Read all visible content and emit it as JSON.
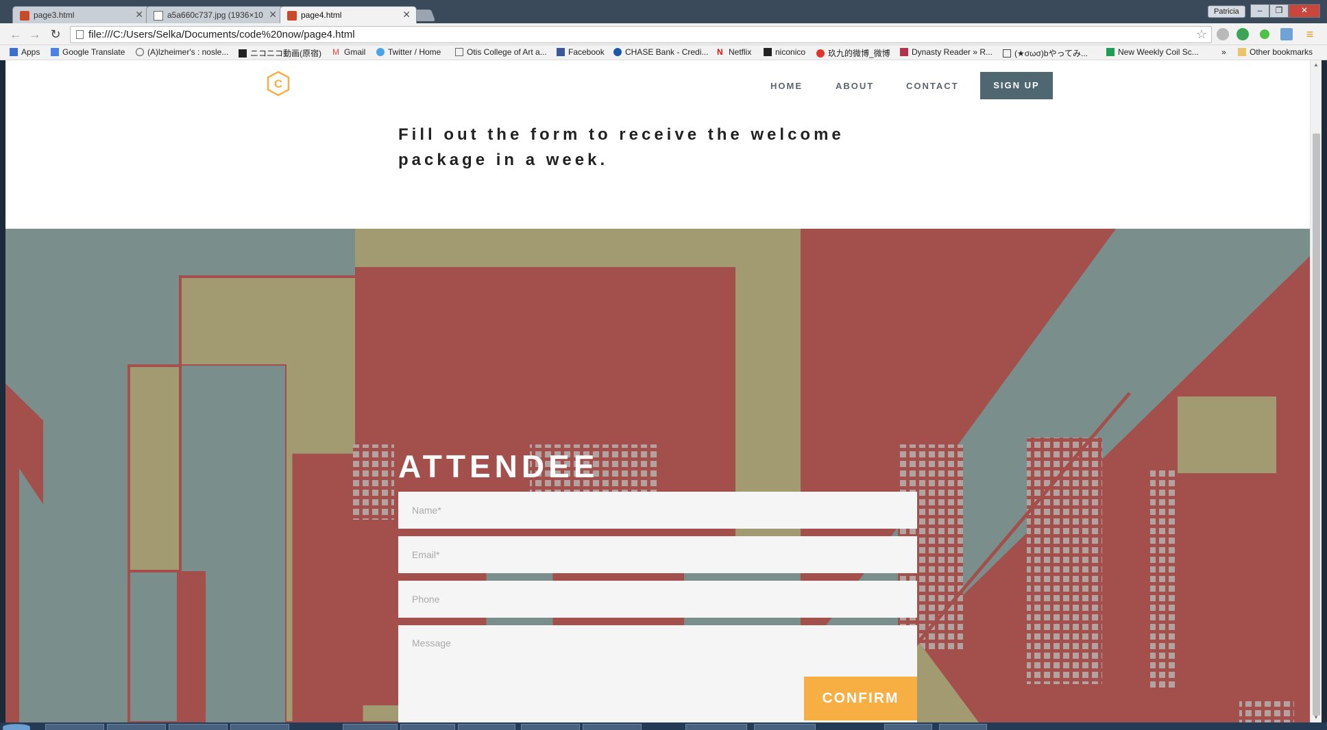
{
  "browser": {
    "tabs": [
      {
        "label": "page3.html",
        "icon": "html-file-icon"
      },
      {
        "label": "a5a660c737.jpg (1936×10",
        "icon": "image-file-icon"
      },
      {
        "label": "page4.html",
        "icon": "html-file-icon",
        "active": true
      }
    ],
    "user": "Patricia",
    "url": "file:///C:/Users/Selka/Documents/code%20now/page4.html",
    "bookmarks": [
      {
        "label": "Apps",
        "icon": "apps-grid-icon"
      },
      {
        "label": "Google Translate",
        "icon": "translate-icon"
      },
      {
        "label": "(A)lzheimer's : nosle...",
        "icon": "reddit-icon"
      },
      {
        "label": "ニコニコ動画(原宿)",
        "icon": "niconico-icon"
      },
      {
        "label": "Gmail",
        "icon": "gmail-icon"
      },
      {
        "label": "Twitter / Home",
        "icon": "twitter-icon"
      },
      {
        "label": "Otis College of Art a...",
        "icon": "page-icon"
      },
      {
        "label": "Facebook",
        "icon": "facebook-icon"
      },
      {
        "label": "CHASE Bank - Credi...",
        "icon": "chase-icon"
      },
      {
        "label": "Netflix",
        "icon": "netflix-icon"
      },
      {
        "label": "niconico",
        "icon": "niconico-icon"
      },
      {
        "label": "玖九的微博_微博",
        "icon": "weibo-icon"
      },
      {
        "label": "Dynasty Reader » R...",
        "icon": "dynasty-icon"
      },
      {
        "label": "(★σωσ)bやってみ...",
        "icon": "tv-icon"
      },
      {
        "label": "New Weekly Coil Sc...",
        "icon": "sheets-icon"
      }
    ],
    "overflow_label": "»",
    "other_bookmarks": "Other bookmarks"
  },
  "site": {
    "nav": [
      {
        "label": "HOME"
      },
      {
        "label": "ABOUT"
      },
      {
        "label": "CONTACT"
      }
    ],
    "signup_label": "SIGN UP",
    "logo_letter": "C",
    "intro_line1": "Fill out the form to receive the welcome",
    "intro_line2": "package in a week.",
    "form_title": "ATTENDEE",
    "fields": {
      "name_placeholder": "Name*",
      "email_placeholder": "Email*",
      "phone_placeholder": "Phone",
      "message_placeholder": "Message"
    },
    "confirm_label": "CONFIRM"
  },
  "colors": {
    "accent": "#f7ae43",
    "signup": "#4e6770",
    "hero_red": "#a34f4c",
    "hero_tan": "#a29a70",
    "hero_teal": "#7a8f8c"
  }
}
